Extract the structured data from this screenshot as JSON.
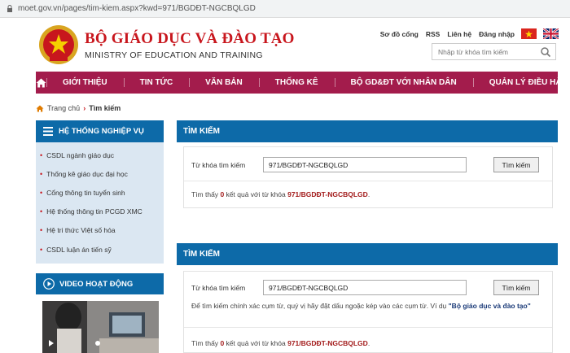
{
  "browser": {
    "url": "moet.gov.vn/pages/tim-kiem.aspx?kwd=971/BGDĐT-NGCBQLGD"
  },
  "header": {
    "title": "BỘ GIÁO DỤC VÀ ĐÀO TẠO",
    "subtitle": "MINISTRY OF EDUCATION AND TRAINING",
    "links": [
      "Sơ đồ cổng",
      "RSS",
      "Liên hệ",
      "Đăng nhập"
    ],
    "search_placeholder": "Nhập từ khóa tìm kiếm",
    "flags": [
      "vietnam-flag-icon",
      "uk-flag-icon"
    ]
  },
  "nav": {
    "items": [
      "GIỚI THIỆU",
      "TIN TỨC",
      "VĂN BẢN",
      "THỐNG KÊ",
      "BỘ GD&ĐT VỚI NHÂN DÂN",
      "QUẢN LÝ ĐIỀU HÀNH"
    ]
  },
  "breadcrumb": {
    "home": "Trang chủ",
    "current": "Tìm kiếm"
  },
  "sidebar": {
    "title": "HỆ THỐNG NGHIỆP VỤ",
    "items": [
      "CSDL ngành giáo dục",
      "Thống kê giáo dục đại học",
      "Cổng thông tin tuyển sinh",
      "Hệ thống thông tin PCGD XMC",
      "Hệ tri thức Việt số hóa",
      "CSDL luận án tiến sỹ"
    ],
    "video_title": "VIDEO HOẠT ĐỘNG"
  },
  "search1": {
    "title": "TÌM KIẾM",
    "label": "Từ khóa tìm kiếm",
    "value": "971/BGDĐT-NGCBQLGD",
    "button": "Tìm kiếm",
    "result_prefix": "Tìm thấy",
    "result_count": "0",
    "result_middle": "kết quả với từ khóa",
    "result_keyword": "971/BGDĐT-NGCBQLGD",
    "result_suffix": "."
  },
  "search2": {
    "title": "TÌM KIẾM",
    "label": "Từ khóa tìm kiếm",
    "value": "971/BGDĐT-NGCBQLGD",
    "button": "Tìm kiếm",
    "hint_prefix": "Để tìm kiếm chính xác cụm từ, quý vị hãy đặt dấu ngoặc kép vào các cụm từ. Ví dụ",
    "hint_example": "\"Bộ giáo dục và đào tạo\"",
    "result_prefix": "Tìm thấy",
    "result_count": "0",
    "result_middle": "kết quả với từ khóa",
    "result_keyword": "971/BGDĐT-NGCBQLGD",
    "result_suffix": "."
  },
  "colors": {
    "nav": "#a31c4c",
    "panel": "#0d6aa8",
    "sidebar_bg": "#dbe7f2",
    "title_red": "#c8161d"
  }
}
